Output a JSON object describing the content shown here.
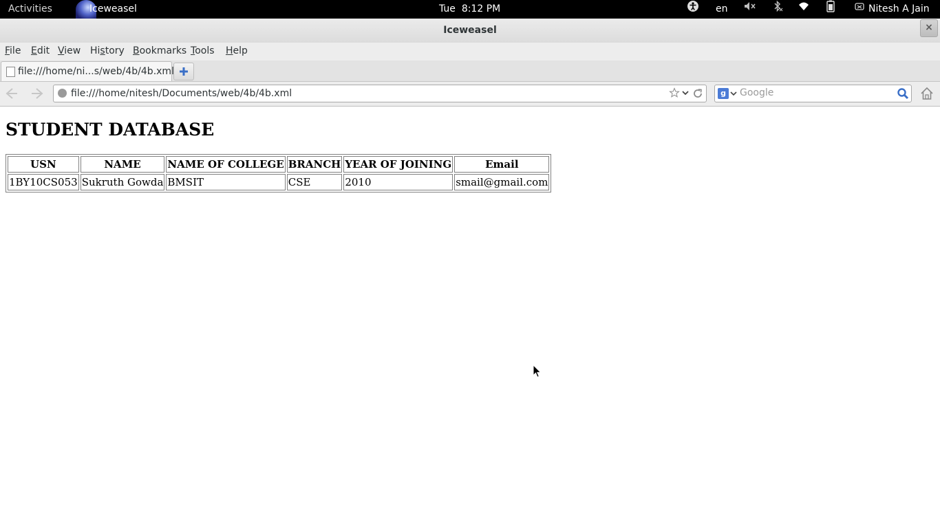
{
  "topbar": {
    "activities": "Activities",
    "app_name": "Iceweasel",
    "clock": "Tue  8:12 PM",
    "language": "en",
    "user": "Nitesh A Jain",
    "icons": [
      "accessibility-icon",
      "volume-muted-icon",
      "bluetooth-off-icon",
      "wifi-icon",
      "battery-icon",
      "user-status-icon"
    ]
  },
  "window": {
    "title": "Iceweasel",
    "close_label": "×"
  },
  "menubar": {
    "items": [
      {
        "label": "File",
        "underline": "F"
      },
      {
        "label": "Edit",
        "underline": "E"
      },
      {
        "label": "View",
        "underline": "V"
      },
      {
        "label": "History",
        "underline": "s"
      },
      {
        "label": "Bookmarks",
        "underline": "B"
      },
      {
        "label": "Tools",
        "underline": "T"
      },
      {
        "label": "Help",
        "underline": "H"
      }
    ]
  },
  "tabs": [
    {
      "label": "file:///home/ni...s/web/4b/4b.xml",
      "active": true
    }
  ],
  "navbar": {
    "url": "file:///home/nitesh/Documents/web/4b/4b.xml",
    "search_placeholder": "Google",
    "search_engine_icon": "g"
  },
  "page": {
    "heading": "STUDENT DATABASE",
    "table": {
      "headers": [
        "USN",
        "NAME",
        "NAME OF COLLEGE",
        "BRANCH",
        "YEAR OF JOINING",
        "Email"
      ],
      "rows": [
        [
          "1BY10CS053",
          "Sukruth Gowda",
          "BMSIT",
          "CSE",
          "2010",
          "smail@gmail.com"
        ]
      ]
    }
  },
  "colors": {
    "topbar_bg": "#000000",
    "titlebar_bg": "#e4e4e4",
    "chrome_bg": "#ededed",
    "page_bg": "#ffffff"
  }
}
